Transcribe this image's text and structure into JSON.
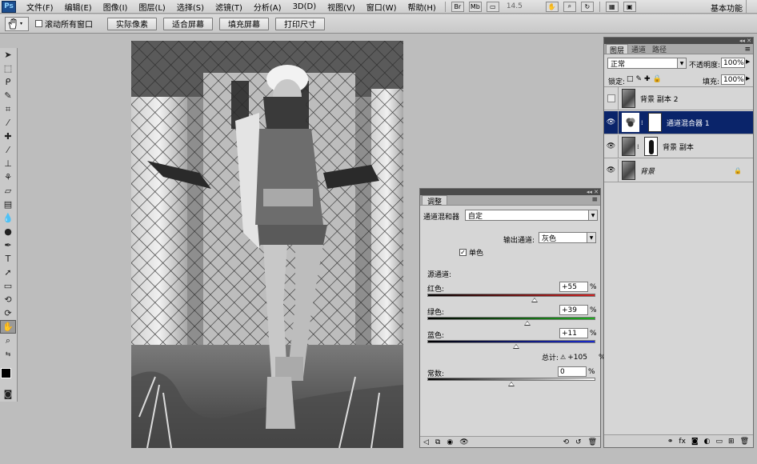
{
  "menubar": {
    "logo": "Ps",
    "items": [
      "文件(F)",
      "编辑(E)",
      "图像(I)",
      "图层(L)",
      "选择(S)",
      "滤镜(T)",
      "分析(A)",
      "3D(D)",
      "视图(V)",
      "窗口(W)",
      "帮助(H)"
    ],
    "br_label": "Br",
    "mb_label": "Mb",
    "zoom": "14.5",
    "workspace": "基本功能"
  },
  "options": {
    "scroll_all_label": "滚动所有窗口",
    "scroll_all_checked": false,
    "buttons": [
      "实际像素",
      "适合屏幕",
      "填充屏幕",
      "打印尺寸"
    ]
  },
  "tools": [
    "move-tool",
    "marquee-tool",
    "lasso-tool",
    "quick-select-tool",
    "crop-tool",
    "eyedropper-tool",
    "healing-brush-tool",
    "brush-tool",
    "clone-stamp-tool",
    "history-brush-tool",
    "eraser-tool",
    "gradient-tool",
    "blur-tool",
    "dodge-tool",
    "pen-tool",
    "type-tool",
    "path-select-tool",
    "shape-tool",
    "3d-rotate-tool",
    "3d-orbit-tool",
    "hand-tool",
    "zoom-tool"
  ],
  "adjustments": {
    "tab": "调整",
    "adj_type_label": "通道混和器",
    "preset": "自定",
    "output_label": "输出通道:",
    "output_value": "灰色",
    "mono_label": "单色",
    "mono_checked": true,
    "source_label": "源通道:",
    "red_label": "红色:",
    "red_value": "+55",
    "red_level": 55,
    "green_label": "绿色:",
    "green_value": "+39",
    "green_level": 39,
    "blue_label": "蓝色:",
    "blue_value": "+11",
    "blue_level": 11,
    "pct": "%",
    "total_label": "总计:",
    "total_value": "+105",
    "constant_label": "常数:",
    "constant_value": "0",
    "constant_level": 0
  },
  "layers": {
    "tabs": [
      "图层",
      "通道",
      "路径"
    ],
    "blend_mode": "正常",
    "opacity_label": "不透明度:",
    "opacity": "100%",
    "lock_label": "锁定:",
    "fill_label": "填充:",
    "fill": "100%",
    "rows": [
      {
        "name": "背景 副本 2",
        "visible": false,
        "selected": false
      },
      {
        "name": "通道混合器 1",
        "visible": true,
        "selected": true
      },
      {
        "name": "背景 副本",
        "visible": true,
        "selected": false
      },
      {
        "name": "背景",
        "visible": true,
        "selected": false
      }
    ]
  },
  "colors": {
    "selection": "#0a246a",
    "red_track": "#d02020",
    "green_track": "#20b020",
    "blue_track": "#1a2bd0"
  }
}
